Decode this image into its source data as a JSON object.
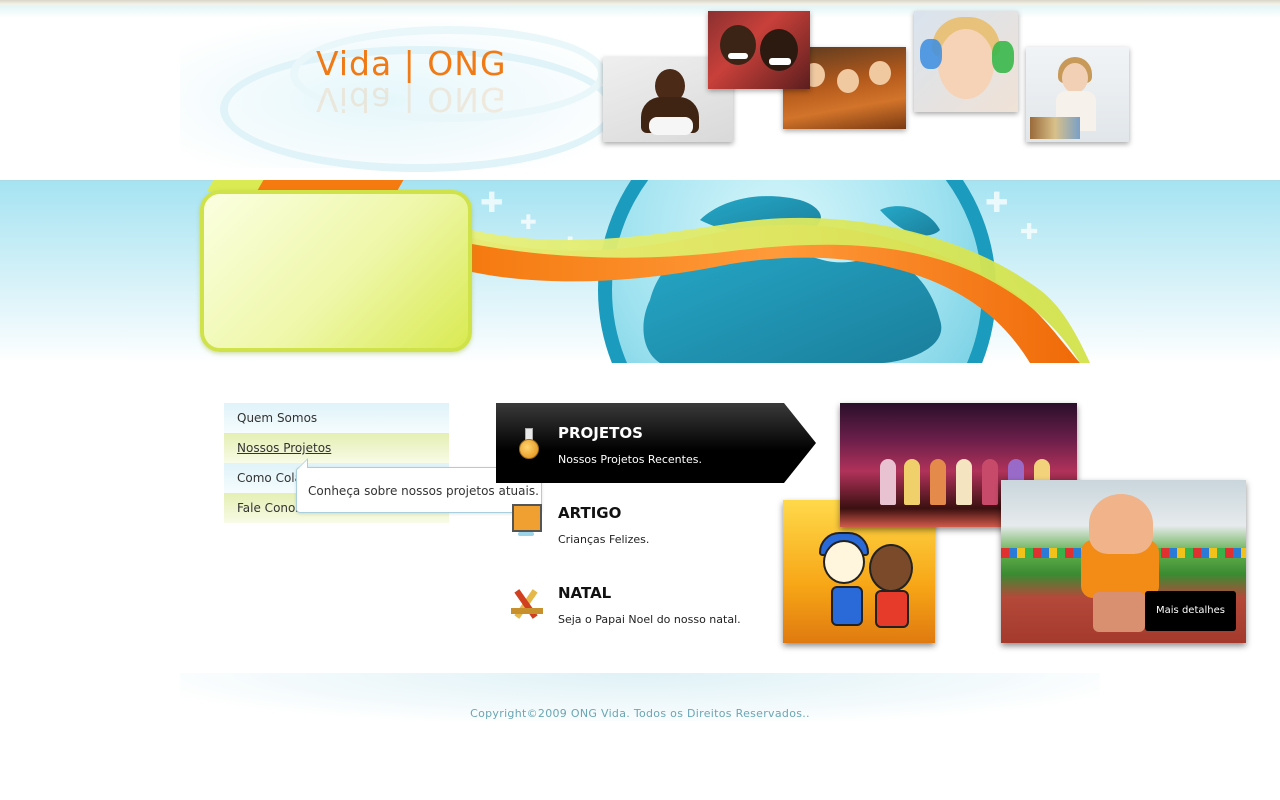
{
  "header": {
    "logo_text": "Vida  |  ONG",
    "brand_color": "#f07a16"
  },
  "nav": {
    "items": [
      {
        "label": "Quem Somos"
      },
      {
        "label": "Nossos Projetos"
      },
      {
        "label": "Como Colaborar"
      },
      {
        "label": "Fale Conosco"
      }
    ],
    "active_index": 1,
    "tooltip": "Conheça sobre nossos projetos atuais."
  },
  "features": [
    {
      "title": "PROJETOS",
      "description": "Nossos Projetos Recentes.",
      "icon": "flask-icon"
    },
    {
      "title": "ARTIGO",
      "description": "Crianças Felizes.",
      "icon": "monitor-icon"
    },
    {
      "title": "NATAL",
      "description": "Seja o Papai Noel do nosso natal.",
      "icon": "tools-icon"
    }
  ],
  "gallery": {
    "more_button": "Mais detalhes"
  },
  "footer": {
    "copyright": "Copyright©2009 ONG Vida. Todos os Direitos Reservados.."
  },
  "colors": {
    "accent_orange": "#f57a10",
    "accent_green": "#d9ea52",
    "sky_blue": "#a5e3f2",
    "footer_text": "#6aa6b6"
  }
}
